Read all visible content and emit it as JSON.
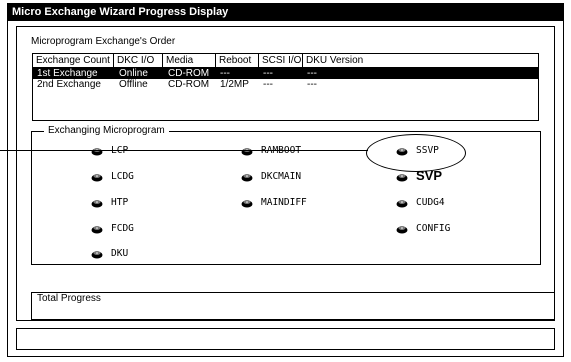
{
  "window": {
    "title": "Micro Exchange Wizard Progress Display"
  },
  "order": {
    "label": "Microprogram Exchange's Order",
    "columns": [
      "Exchange Count",
      "DKC I/O",
      "Media",
      "Reboot",
      "SCSI I/O",
      "DKU Version"
    ],
    "rows": [
      {
        "selected": true,
        "cells": [
          "1st Exchange",
          "Online",
          "CD-ROM",
          "---",
          "---",
          "---"
        ]
      },
      {
        "selected": false,
        "cells": [
          "2nd Exchange",
          "Offline",
          "CD-ROM",
          "1/2MP",
          "---",
          "---"
        ]
      }
    ]
  },
  "exchanging": {
    "label": "Exchanging Microprogram",
    "items": {
      "lcp": "LCP",
      "ramboot": "RAMBOOT",
      "ssvp": "SSVP",
      "lcdg": "LCDG",
      "dkcmain": "DKCMAIN",
      "svp": "SVP",
      "htp": "HTP",
      "maindiff": "MAINDIFF",
      "cudg4": "CUDG4",
      "fcdg": "FCDG",
      "config": "CONFIG",
      "dku": "DKU"
    }
  },
  "progress": {
    "label": "Total Progress",
    "value": 0
  },
  "status": {
    "text": ""
  }
}
